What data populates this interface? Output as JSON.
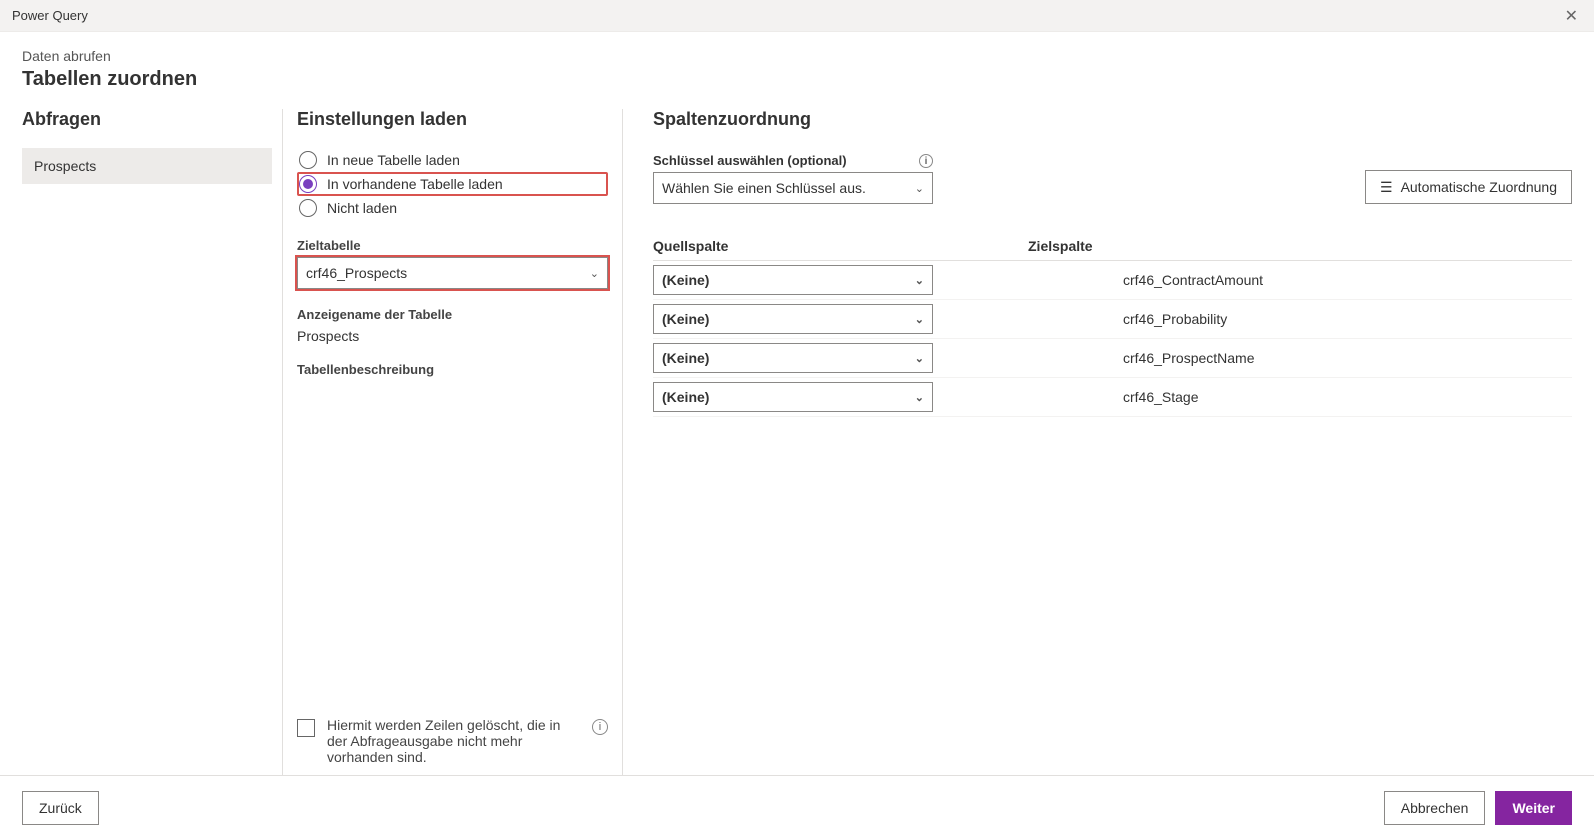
{
  "titlebar": {
    "title": "Power Query",
    "close": "✕"
  },
  "header": {
    "breadcrumb": "Daten abrufen",
    "title": "Tabellen zuordnen"
  },
  "queries": {
    "heading": "Abfragen",
    "items": [
      "Prospects"
    ]
  },
  "settings": {
    "heading": "Einstellungen laden",
    "radios": {
      "new": "In neue Tabelle laden",
      "existing": "In vorhandene Tabelle laden",
      "none": "Nicht laden"
    },
    "target_label": "Zieltabelle",
    "target_value": "crf46_Prospects",
    "display_label": "Anzeigename der Tabelle",
    "display_value": "Prospects",
    "desc_label": "Tabellenbeschreibung",
    "delete_rows": "Hiermit werden Zeilen gelöscht, die in der Abfrageausgabe nicht mehr vorhanden sind."
  },
  "mapping": {
    "heading": "Spaltenzuordnung",
    "key_label": "Schlüssel auswählen (optional)",
    "key_placeholder": "Wählen Sie einen Schlüssel aus.",
    "auto_label": "Automatische Zuordnung",
    "col_src": "Quellspalte",
    "col_dst": "Zielspalte",
    "none": "(Keine)",
    "rows": [
      {
        "dst": "crf46_ContractAmount"
      },
      {
        "dst": "crf46_Probability"
      },
      {
        "dst": "crf46_ProspectName"
      },
      {
        "dst": "crf46_Stage"
      }
    ]
  },
  "footer": {
    "back": "Zurück",
    "cancel": "Abbrechen",
    "next": "Weiter"
  }
}
